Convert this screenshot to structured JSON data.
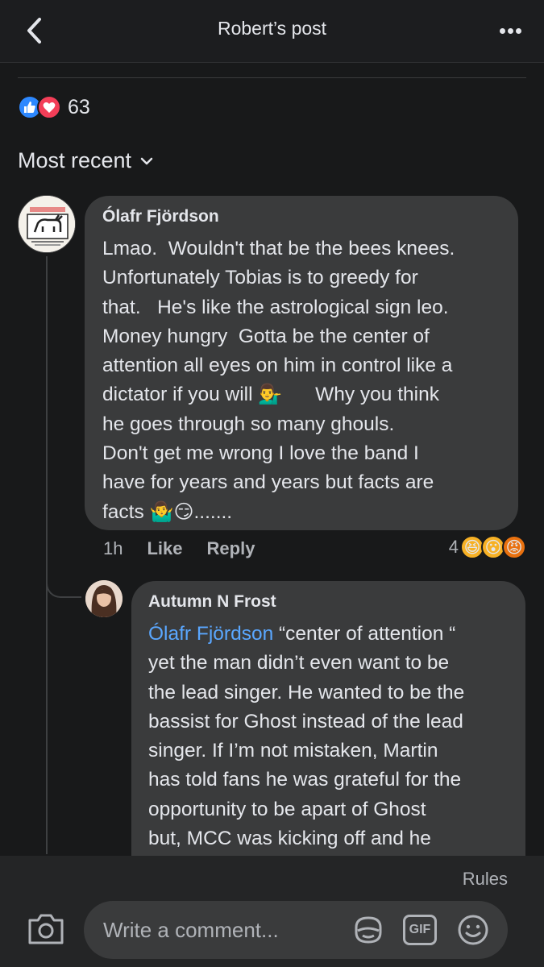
{
  "header": {
    "title": "Robert’s post"
  },
  "post_reactions": {
    "count": "63"
  },
  "sort": {
    "label": "Most recent"
  },
  "comments": [
    {
      "author": "Ólafr Fjördson",
      "text_lines": [
        "Lmao.  Wouldn't that be the bees knees.",
        "Unfortunately Tobias is to greedy for",
        "that.   He's like the astrological sign leo.",
        "Money hungry  Gotta be the center of",
        "attention all eyes on him in control like a",
        "dictator if you will ",
        "      Why you think",
        "he goes through so many ghouls.",
        "Don't get me wrong I love the band I",
        "have for years and years but facts are",
        "facts ",
        "......."
      ],
      "emoji_a": "💁‍♂️",
      "emoji_b": "🤷‍♂️",
      "emoji_c": "😏",
      "time": "1h",
      "like_label": "Like",
      "reply_label": "Reply",
      "reaction_count": "4",
      "reaction_emojis": [
        "😆",
        "😮",
        "😡"
      ]
    },
    {
      "author": "Autumn N Frost",
      "mention": "Ólafr Fjördson",
      "text_first": " “center of attention “",
      "text_lines": [
        "yet the man didn’t even want to be",
        "the lead singer. He wanted to be the",
        "bassist for Ghost instead of the lead",
        "singer. If I’m not mistaken, Martin",
        "has told fans he was grateful for the",
        "opportunity to be apart of Ghost",
        "but, MCC was kicking off and he"
      ]
    }
  ],
  "composer": {
    "rules_label": "Rules",
    "placeholder": "Write a comment...",
    "gif_label": "GIF"
  },
  "icons": {
    "back": "chevron-left-icon",
    "more": "more-horizontal-icon",
    "camera": "camera-icon",
    "sticker": "sticker-icon",
    "smile": "smile-icon",
    "like": "like-icon",
    "love": "love-icon",
    "chevron": "chevron-down-icon"
  },
  "colors": {
    "background": "#18191a",
    "bubble": "#3a3b3c",
    "mention": "#5aa7ff",
    "like_blue": "#2d88ff",
    "love_red": "#f33e58"
  }
}
